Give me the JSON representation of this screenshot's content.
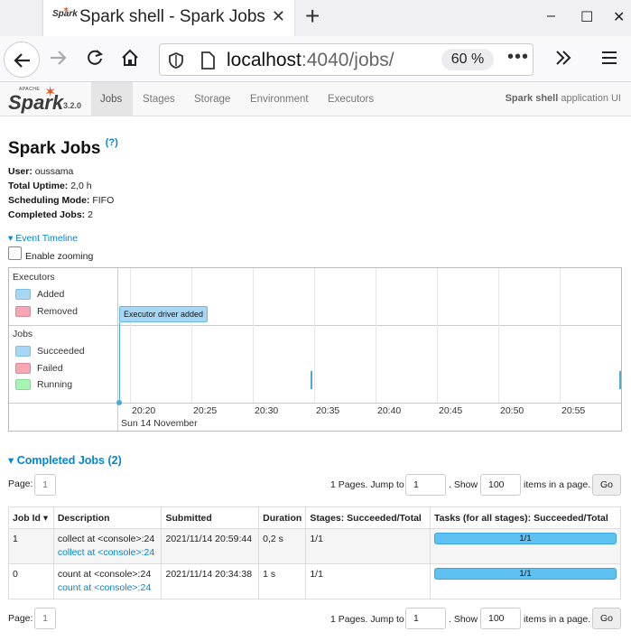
{
  "browser": {
    "tab_title": "Spark shell - Spark Jobs",
    "favicon_text": "Spark",
    "url_host": "localhost",
    "url_rest": ":4040/jobs/",
    "zoom": "60 %"
  },
  "spark_header": {
    "logo_apache": "APACHE",
    "logo_text": "Spark",
    "version": "3.2.0",
    "tabs": [
      {
        "label": "Jobs",
        "active": true
      },
      {
        "label": "Stages",
        "active": false
      },
      {
        "label": "Storage",
        "active": false
      },
      {
        "label": "Environment",
        "active": false
      },
      {
        "label": "Executors",
        "active": false
      }
    ],
    "app_name_bold": "Spark shell",
    "app_name_suffix": " application UI"
  },
  "summary": {
    "title": "Spark Jobs",
    "help": "(?)",
    "user_label": "User:",
    "user": "oussama",
    "uptime_label": "Total Uptime:",
    "uptime": "2,0 h",
    "scheduling_label": "Scheduling Mode:",
    "scheduling": "FIFO",
    "completed_label": "Completed Jobs:",
    "completed": "2"
  },
  "timeline": {
    "toggle_label": "Event Timeline",
    "zoom_label": "Enable zooming",
    "executors_group": "Executors",
    "executor_legend": [
      {
        "label": "Added",
        "color": "#a6d8f5"
      },
      {
        "label": "Removed",
        "color": "#f7a6b3"
      }
    ],
    "jobs_group": "Jobs",
    "jobs_legend": [
      {
        "label": "Succeeded",
        "color": "#a6d8f5"
      },
      {
        "label": "Failed",
        "color": "#f7a6b3"
      },
      {
        "label": "Running",
        "color": "#a6f5b3"
      }
    ],
    "event_label": "Executor driver added",
    "ticks": [
      "20:20",
      "20:25",
      "20:30",
      "20:35",
      "20:40",
      "20:45",
      "20:50",
      "20:55"
    ],
    "date": "Sun 14 November"
  },
  "completed_jobs": {
    "title": "Completed Jobs (2)",
    "pager": {
      "page_label": "Page:",
      "current_page": "1",
      "pages_text": "1 Pages. Jump to",
      "jump_value": "1",
      "show_text": ". Show",
      "show_value": "100",
      "items_text": "items in a page.",
      "go_label": "Go"
    },
    "columns": [
      "Job Id ▾",
      "Description",
      "Submitted",
      "Duration",
      "Stages: Succeeded/Total",
      "Tasks (for all stages): Succeeded/Total"
    ],
    "rows": [
      {
        "id": "1",
        "desc": "collect at <console>:24",
        "desc_link": "collect at <console>:24",
        "submitted": "2021/11/14 20:59:44",
        "duration": "0,2 s",
        "stages": "1/1",
        "tasks": "1/1",
        "tasks_fraction": 1.0
      },
      {
        "id": "0",
        "desc": "count at <console>:24",
        "desc_link": "count at <console>:24",
        "submitted": "2021/11/14 20:34:38",
        "duration": "1 s",
        "stages": "1/1",
        "tasks": "1/1",
        "tasks_fraction": 1.0
      }
    ]
  }
}
